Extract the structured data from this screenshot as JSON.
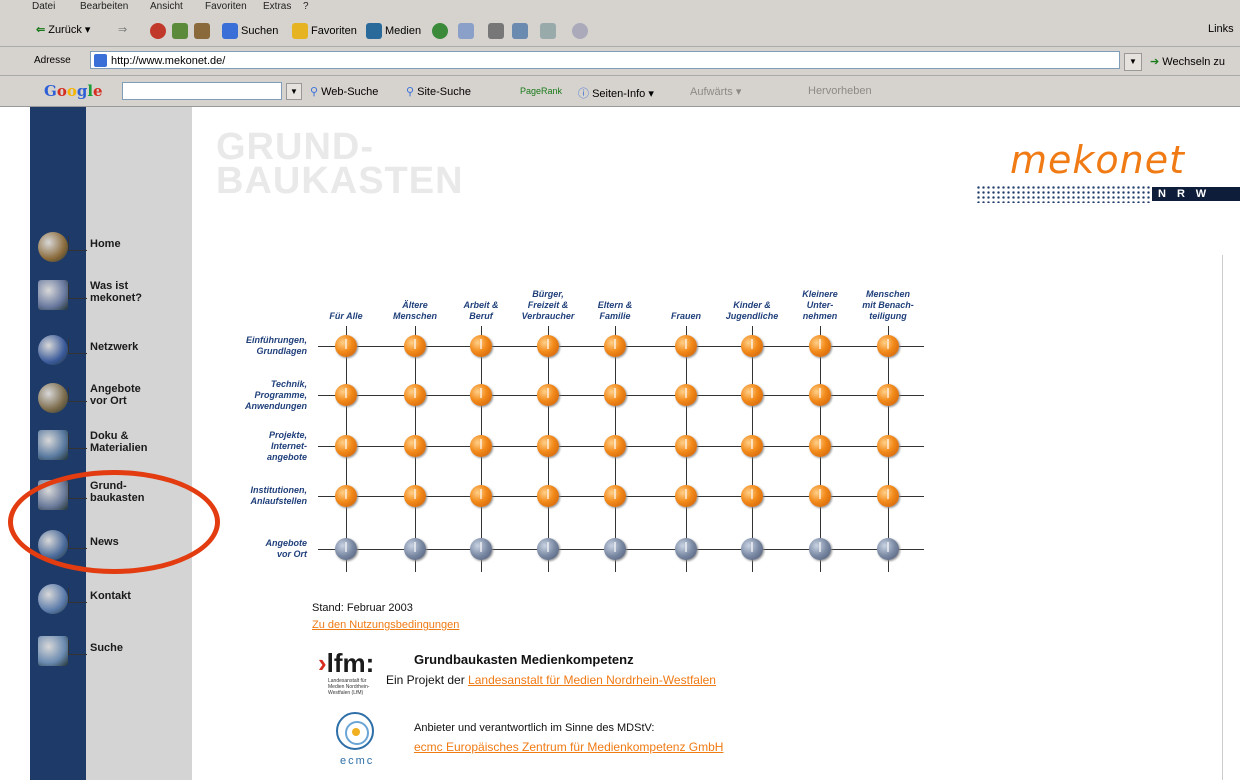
{
  "browser": {
    "menu": [
      "Datei",
      "Bearbeiten",
      "Ansicht",
      "Favoriten",
      "Extras",
      "?"
    ],
    "toolbar": {
      "back": "Zurück",
      "search": "Suchen",
      "favorites": "Favoriten",
      "media": "Medien",
      "links": "Links"
    },
    "address_label": "Adresse",
    "address_value": "http://www.mekonet.de/",
    "go_label": "Wechseln zu",
    "google": {
      "logo": [
        "G",
        "o",
        "o",
        "g",
        "l",
        "e"
      ],
      "web_search": "Web-Suche",
      "site_search": "Site-Suche",
      "pagerank": "PageRank",
      "page_info": "Seiten-Info",
      "up": "Aufwärts",
      "highlight": "Hervorheben"
    }
  },
  "site": {
    "title": "GRUND-\nBAUKASTEN",
    "logo": "mekonet",
    "logo_sub": "NRW",
    "nav": [
      {
        "label": "Home",
        "icon": "home-icon"
      },
      {
        "label": "Was ist\nmekonet?",
        "icon": "info-icon"
      },
      {
        "label": "Netzwerk",
        "icon": "network-icon"
      },
      {
        "label": "Angebote\nvor Ort",
        "icon": "people-icon"
      },
      {
        "label": "Doku &\nMaterialien",
        "icon": "document-icon"
      },
      {
        "label": "Grund-\nbaukasten",
        "icon": "grid-icon"
      },
      {
        "label": "News",
        "icon": "news-icon"
      },
      {
        "label": "Kontakt",
        "icon": "contact-icon"
      },
      {
        "label": "Suche",
        "icon": "search-icon"
      }
    ],
    "columns": [
      "Für Alle",
      "Ältere\nMenschen",
      "Arbeit &\nBeruf",
      "Bürger,\nFreizeit &\nVerbraucher",
      "Eltern &\nFamilie",
      "Frauen",
      "Kinder &\nJugendliche",
      "Kleinere\nUnter-\nnehmen",
      "Menschen\nmit Benach-\nteiligung"
    ],
    "rows": [
      "Einführungen,\nGrundlagen",
      "Technik,\nProgramme,\nAnwendungen",
      "Projekte,\nInternet-\nangebote",
      "Institutionen,\nAnlaufstellen",
      "Angebote\nvor Ort"
    ],
    "stand": "Stand: Februar 2003",
    "nutzung_link": "Zu den Nutzungsbedingungen",
    "lfm_logo": "lfm:",
    "lfm_sub": "Landesanstalt für Medien Nordrhein-Westfalen (LfM)",
    "gbk_title": "Grundbaukasten Medienkompetenz",
    "gbk_text": "Ein Projekt der",
    "gbk_link": "Landesanstalt für Medien Nordrhein-Westfalen",
    "anbieter_text": "Anbieter und verantwortlich im Sinne des MDStV:",
    "ecmc_link": "ecmc Europäisches Zentrum für Medienkompetenz GmbH",
    "ecmc_logo": "ecmc"
  },
  "colors": {
    "nav_dark": "#1e3a68",
    "accent_orange": "#f07a14",
    "highlight_red": "#e23c10"
  }
}
